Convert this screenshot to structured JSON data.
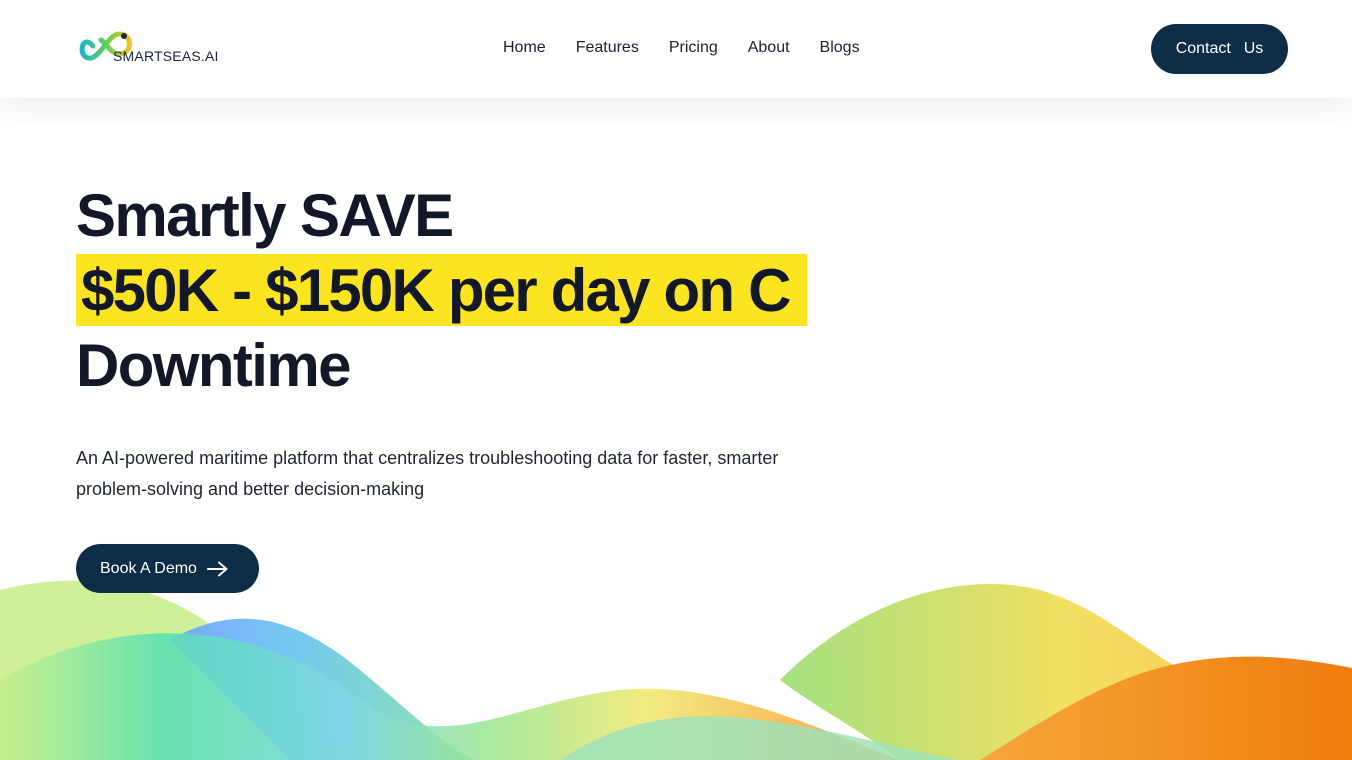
{
  "header": {
    "logo_text": "SMARTSEAS.AI",
    "nav": [
      "Home",
      "Features",
      "Pricing",
      "About",
      "Blogs"
    ],
    "contact_label": "Contact  Us"
  },
  "hero": {
    "line1": "Smartly SAVE",
    "highlight": "$50K - $150K per day on C",
    "line3": "Downtime",
    "description": "An AI-powered maritime platform that centralizes troubleshooting data for faster, smarter problem-solving and better decision-making",
    "cta_label": "Book A Demo",
    "cta_icon": "arrow-right-icon"
  },
  "colors": {
    "primary": "#0d2c46",
    "highlight": "#fce420",
    "text": "#121827"
  }
}
